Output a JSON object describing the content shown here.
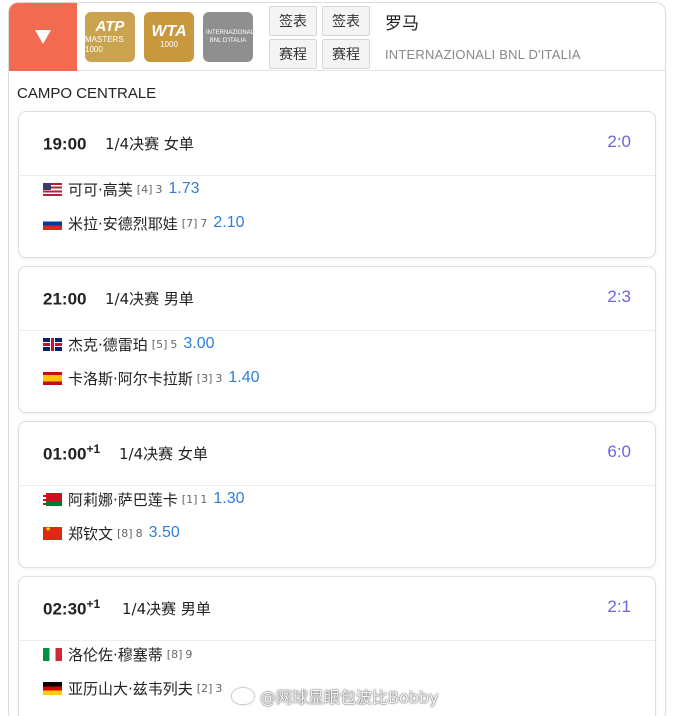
{
  "header": {
    "tournament_name": "罗马",
    "tournament_subtitle": "INTERNAZIONALI BNL D'ITALIA",
    "buttons": [
      "签表",
      "签表",
      "赛程",
      "赛程"
    ],
    "badges": {
      "atp": {
        "main": "ATP",
        "sub": "MASTERS 1000"
      },
      "wta": {
        "main": "WTA",
        "sub": "1000"
      },
      "ibi": {
        "main": "INTERNAZIONALI BNL D'ITALIA",
        "sub": ""
      }
    },
    "colors": {
      "toggle": "#f26a4f",
      "atp": "#c9a34e",
      "wta": "#c8983e"
    }
  },
  "court": "CAMPO CENTRALE",
  "matches": [
    {
      "time": "19:00",
      "time_suffix": "",
      "round": "1/4决赛 女单",
      "score": "2:0",
      "players": [
        {
          "flag": "us",
          "name": "可可·高芙",
          "seed": "[4]",
          "games": "3",
          "odds": "1.73"
        },
        {
          "flag": "ru",
          "name": "米拉·安德烈耶娃",
          "seed": "[7]",
          "games": "7",
          "odds": "2.10"
        }
      ]
    },
    {
      "time": "21:00",
      "time_suffix": "",
      "round": "1/4决赛 男单",
      "score": "2:3",
      "players": [
        {
          "flag": "gb",
          "name": "杰克·德雷珀",
          "seed": "[5]",
          "games": "5",
          "odds": "3.00"
        },
        {
          "flag": "es",
          "name": "卡洛斯·阿尔卡拉斯",
          "seed": "[3]",
          "games": "3",
          "odds": "1.40"
        }
      ]
    },
    {
      "time": "01:00",
      "time_suffix": "+1",
      "round": "1/4决赛 女单",
      "score": "6:0",
      "players": [
        {
          "flag": "by",
          "name": "阿莉娜·萨巴莲卡",
          "seed": "[1]",
          "games": "1",
          "odds": "1.30"
        },
        {
          "flag": "cn",
          "name": "郑钦文",
          "seed": "[8]",
          "games": "8",
          "odds": "3.50"
        }
      ]
    },
    {
      "time": "02:30",
      "time_suffix": "+1",
      "round": "1/4决赛 男单",
      "score": "2:1",
      "players": [
        {
          "flag": "it",
          "name": "洛伦佐·穆塞蒂",
          "seed": "[8]",
          "games": "9",
          "odds": ""
        },
        {
          "flag": "de",
          "name": "亚历山大·兹韦列夫",
          "seed": "[2]",
          "games": "3",
          "odds": ""
        }
      ]
    }
  ],
  "watermark": "@网球显眼包波比Bobby",
  "accent_colors": {
    "score": "#6b66e0",
    "odds": "#2f7ed8"
  }
}
